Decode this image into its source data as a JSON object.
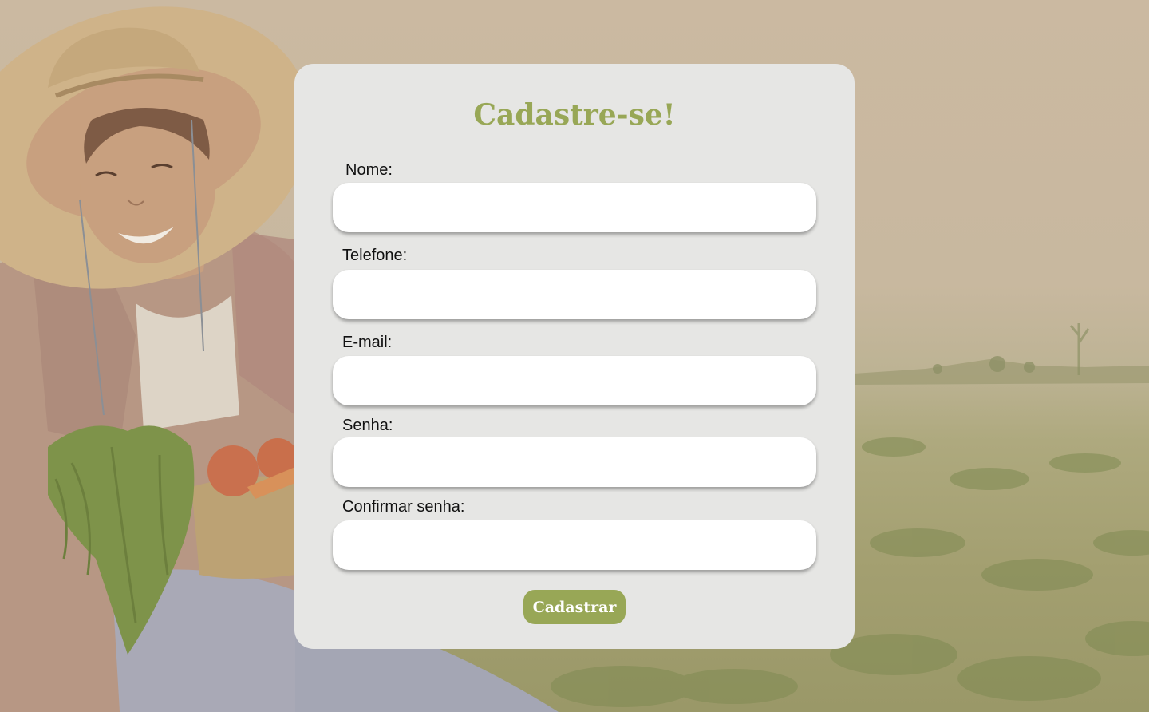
{
  "form": {
    "title": "Cadastre-se!",
    "fields": [
      {
        "label": "Nome:",
        "value": "",
        "placeholder": ""
      },
      {
        "label": "Telefone:",
        "value": "",
        "placeholder": ""
      },
      {
        "label": "E-mail:",
        "value": "",
        "placeholder": ""
      },
      {
        "label": "Senha:",
        "value": "",
        "placeholder": ""
      },
      {
        "label": "Confirmar senha:",
        "value": "",
        "placeholder": ""
      }
    ],
    "submit_label": "Cadastrar"
  },
  "theme": {
    "accent": "#98a756",
    "card_background": "#e6e6e4",
    "field_background": "#ffffff"
  }
}
